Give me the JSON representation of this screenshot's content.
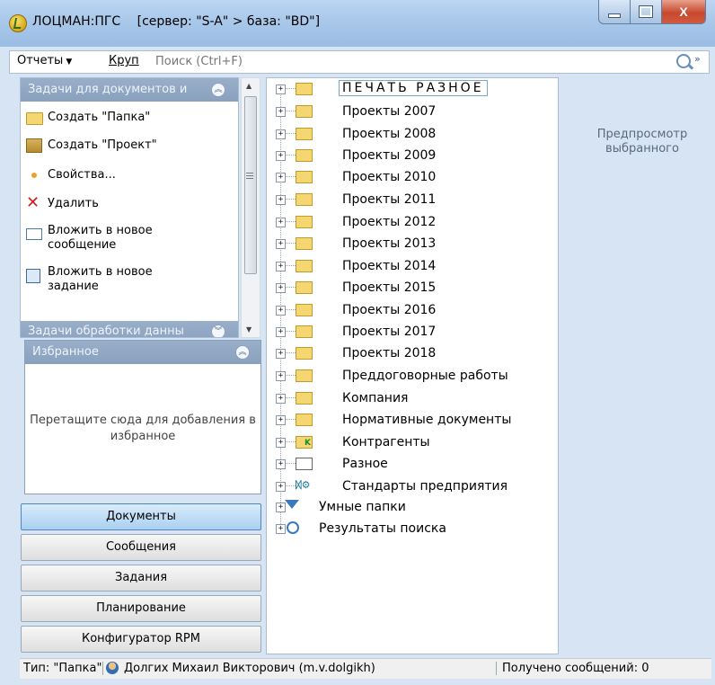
{
  "window": {
    "title": "ЛОЦМАН:ПГС",
    "server": "[сервер: \"S-A\" > база: \"BD\"]",
    "close_glyph": "X"
  },
  "toolbar": {
    "reports": "Отчеты",
    "krup": "Круп",
    "search_placeholder": "Поиск (Ctrl+F)",
    "more": "»"
  },
  "tasks_panel": {
    "title": "Задачи для документов и",
    "items": [
      {
        "label": "Создать \"Папка\"",
        "icon": "folder-icon"
      },
      {
        "label": "Создать \"Проект\"",
        "icon": "project-icon"
      },
      {
        "label": "Свойства...",
        "icon": "bullet-icon"
      },
      {
        "label": "Удалить",
        "icon": "delete-icon"
      },
      {
        "label": "Вложить в новое сообщение",
        "icon": "mail-icon"
      },
      {
        "label": "Вложить в новое задание",
        "icon": "task-icon"
      }
    ],
    "second_title": "Задачи обработки данны"
  },
  "favorites": {
    "title": "Избранное",
    "hint": "Перетащите сюда для добавления в избранное"
  },
  "nav": {
    "documents": "Документы",
    "messages": "Сообщения",
    "tasks": "Задания",
    "planning": "Планирование",
    "configurator": "Конфигуратор RPM"
  },
  "tree": {
    "items": [
      "ПЕЧАТЬ РАЗНОЕ",
      "Проекты 2007",
      "Проекты 2008",
      "Проекты 2009",
      "Проекты 2010",
      "Проекты 2011",
      "Проекты 2012",
      "Проекты 2013",
      "Проекты 2014",
      "Проекты 2015",
      "Проекты 2016",
      "Проекты 2017",
      "Проекты 2018",
      "Преддоговорные работы",
      "Компания",
      "Нормативные документы",
      "Контрагенты",
      "Разное",
      "Стандарты предприятия",
      "Умные папки",
      "Результаты поиска"
    ]
  },
  "preview": {
    "text": "Предпросмотр выбранного"
  },
  "status": {
    "type": "Тип: \"Папка\"",
    "user": "Долгих Михаил Викторович (m.v.dolgikh)",
    "messages": "Получено сообщений: 0"
  }
}
